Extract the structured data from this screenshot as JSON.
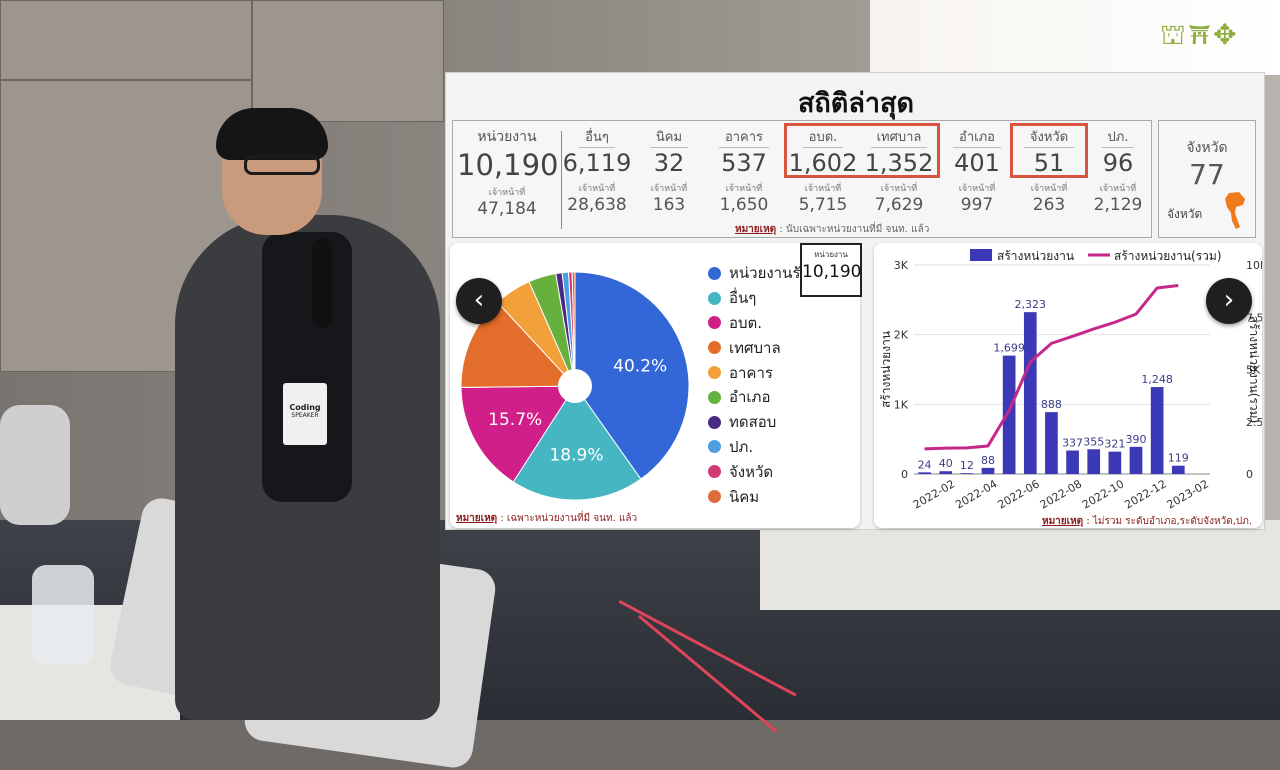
{
  "slide": {
    "title": "สถิติล่าสุด",
    "main_stat": {
      "label": "หน่วยงาน",
      "value": "10,190",
      "sub_label": "เจ้าหน้าที่",
      "sub_value": "47,184"
    },
    "stats": [
      {
        "label": "อื่นๆ",
        "value": "6,119",
        "sub_label": "เจ้าหน้าที่",
        "sub_value": "28,638"
      },
      {
        "label": "นิคม",
        "value": "32",
        "sub_label": "เจ้าหน้าที่",
        "sub_value": "163"
      },
      {
        "label": "อาคาร",
        "value": "537",
        "sub_label": "เจ้าหน้าที่",
        "sub_value": "1,650"
      },
      {
        "label": "อบต.",
        "value": "1,602",
        "sub_label": "เจ้าหน้าที่",
        "sub_value": "5,715"
      },
      {
        "label": "เทศบาล",
        "value": "1,352",
        "sub_label": "เจ้าหน้าที่",
        "sub_value": "7,629"
      },
      {
        "label": "อำเภอ",
        "value": "401",
        "sub_label": "เจ้าหน้าที่",
        "sub_value": "997"
      },
      {
        "label": "จังหวัด",
        "value": "51",
        "sub_label": "เจ้าหน้าที่",
        "sub_value": "263"
      },
      {
        "label": "ปภ.",
        "value": "96",
        "sub_label": "เจ้าหน้าที่",
        "sub_value": "2,129"
      }
    ],
    "stats_note": {
      "prefix": "หมายเหตุ",
      "text": " : นับเฉพาะหน่วยงานที่มี จนท. แล้ว"
    },
    "province_box": {
      "label": "จังหวัด",
      "value": "77",
      "sub_label": "จังหวัด"
    },
    "pie_note": {
      "prefix": "หมายเหตุ",
      "text": " : เฉพาะหน่วยงานที่มี จนท. แล้ว"
    },
    "bar_note": {
      "prefix": "หมายเหตุ",
      "text": " : ไม่รวม ระดับอำเภอ,ระดับจังหวัด,ปภ."
    },
    "kpi": {
      "label": "หน่วยงาน",
      "value": "10,190"
    },
    "nav_prev": "‹",
    "nav_next": "›",
    "highlight_color": "#d9533f"
  },
  "badge": {
    "event": "Coding",
    "role": "SPEAKER"
  },
  "logo": "⛫⛩✥",
  "chart_data": [
    {
      "type": "pie",
      "labels": [
        "หน่วยงานรั",
        "อื่นๆ",
        "อบต.",
        "เทศบาล",
        "อาคาร",
        "อำเภอ",
        "ทดสอบ",
        "ปภ.",
        "จังหวัด",
        "นิคม"
      ],
      "values": [
        40.2,
        18.9,
        15.7,
        13.3,
        5.3,
        3.9,
        0.9,
        0.9,
        0.5,
        0.4
      ],
      "data_labels": [
        "40.2%",
        "18.9%",
        "15.7%"
      ],
      "colors": [
        "#3366d6",
        "#46b7c2",
        "#d11f8a",
        "#e36d2a",
        "#f2a13a",
        "#66b13e",
        "#4b2a86",
        "#4d9ee0",
        "#d13a73",
        "#e06b3c"
      ],
      "legend": "right"
    },
    {
      "type": "bar",
      "categories": [
        "2022-01",
        "2022-02",
        "2022-03",
        "2022-04",
        "2022-05",
        "2022-06",
        "2022-07",
        "2022-08",
        "2022-09",
        "2022-10",
        "2022-11",
        "2022-12",
        "2023-01",
        "2023-02"
      ],
      "x_tick_labels": [
        "2022-02",
        "2022-04",
        "2022-06",
        "2022-08",
        "2022-10",
        "2022-12",
        "2023-02"
      ],
      "series": [
        {
          "name": "สร้างหน่วยงาน",
          "type": "bar",
          "axis": "left",
          "color": "#3b39b5",
          "values": [
            24,
            40,
            12,
            88,
            1699,
            2323,
            888,
            337,
            355,
            321,
            390,
            1248,
            119
          ],
          "data_labels": [
            "24",
            "40",
            "12",
            "88",
            "1,699",
            "2,323",
            "888",
            "337",
            "355",
            "321",
            "390",
            "1,248",
            "119"
          ]
        },
        {
          "name": "สร้างหน่วยงาน(รวม)",
          "type": "line",
          "axis": "right",
          "color": "#c6278c",
          "values": [
            1200,
            1240,
            1250,
            1340,
            3040,
            5360,
            6250,
            6590,
            6940,
            7260,
            7650,
            8900,
            9020
          ]
        }
      ],
      "ylabel": "สร้างหน่วยงาน",
      "y2label": "สร้างหน่วยงาน(รวม)",
      "yticks": [
        "0",
        "1K",
        "2K",
        "3K"
      ],
      "y2ticks": [
        "0",
        "2.5K",
        "5K",
        "7.5K",
        "10K"
      ],
      "ylim": [
        0,
        3000
      ],
      "y2lim": [
        0,
        10000
      ],
      "grid": true,
      "legend": "top"
    }
  ]
}
